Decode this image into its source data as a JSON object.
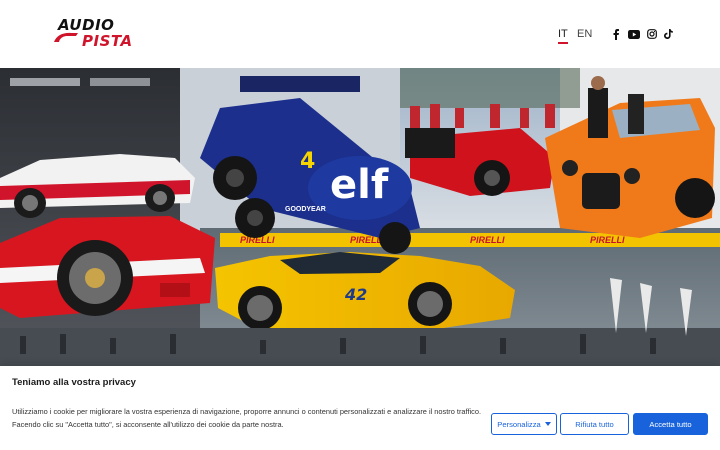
{
  "header": {
    "logo": {
      "line1": "AUDIO",
      "line2": "PISTA"
    },
    "languages": [
      {
        "code": "IT",
        "active": true
      },
      {
        "code": "EN",
        "active": false
      }
    ],
    "social_icons": [
      "facebook-icon",
      "youtube-icon",
      "instagram-icon",
      "tiktok-icon"
    ]
  },
  "hero": {
    "car_numbers": [
      "4",
      "42"
    ],
    "signage": [
      "PIRELLI",
      "elf",
      "GOODYEAR"
    ]
  },
  "cookie_banner": {
    "title": "Teniamo alla vostra privacy",
    "text": "Utilizziamo i cookie per migliorare la vostra esperienza di navigazione, proporre annunci o contenuti personalizzati e analizzare il nostro traffico. Facendo clic su \"Accetta tutto\", si acconsente all'utilizzo dei cookie da parte nostra.",
    "customize_label": "Personalizza",
    "reject_label": "Rifiuta tutto",
    "accept_label": "Accetta tutto"
  },
  "colors": {
    "brand_red": "#d0142b",
    "button_blue": "#1863dc"
  }
}
